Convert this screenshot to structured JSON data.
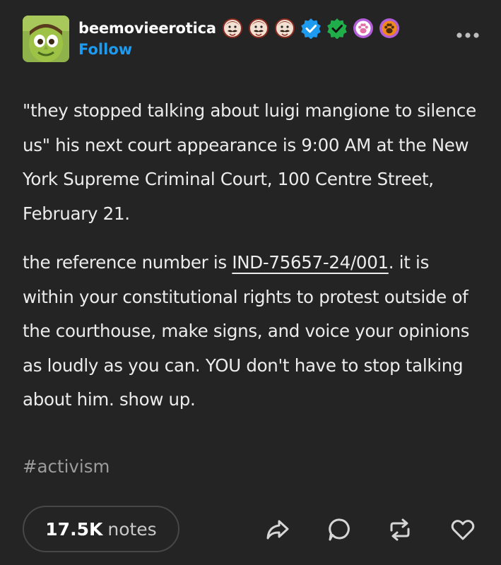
{
  "post": {
    "author": {
      "username": "beemovieerotica",
      "follow_label": "Follow",
      "avatar_icon": "green-cartoon-face-avatar",
      "badges": [
        "mustache-man-badge",
        "mustache-man-badge",
        "mustache-man-badge",
        "blue-verified-badge",
        "green-verified-badge",
        "purple-paw-badge",
        "orange-paw-badge"
      ]
    },
    "more_icon": "ellipsis-icon",
    "paragraph_1": "\"they stopped talking about luigi mangione to silence us\" his next court appearance is 9:00 AM at the New York Supreme Criminal Court, 100 Centre Street, February 21.",
    "paragraph_2": {
      "before_link": "the reference number is ",
      "link": "IND-75657-24/001",
      "after_link": ". it is within your constitutional rights to protest outside of the courthouse, make signs, and voice your opinions as loudly as you can. YOU don't have to stop talking about him. show up."
    },
    "tag": "#activism",
    "notes": {
      "count": "17.5K",
      "label": "notes"
    },
    "actions": [
      "share-icon",
      "reply-icon",
      "reblog-icon",
      "like-icon"
    ]
  },
  "colors": {
    "background": "#242424",
    "text": "#ececec",
    "follow": "#1d9bf0",
    "tag": "#9c9c9c"
  }
}
